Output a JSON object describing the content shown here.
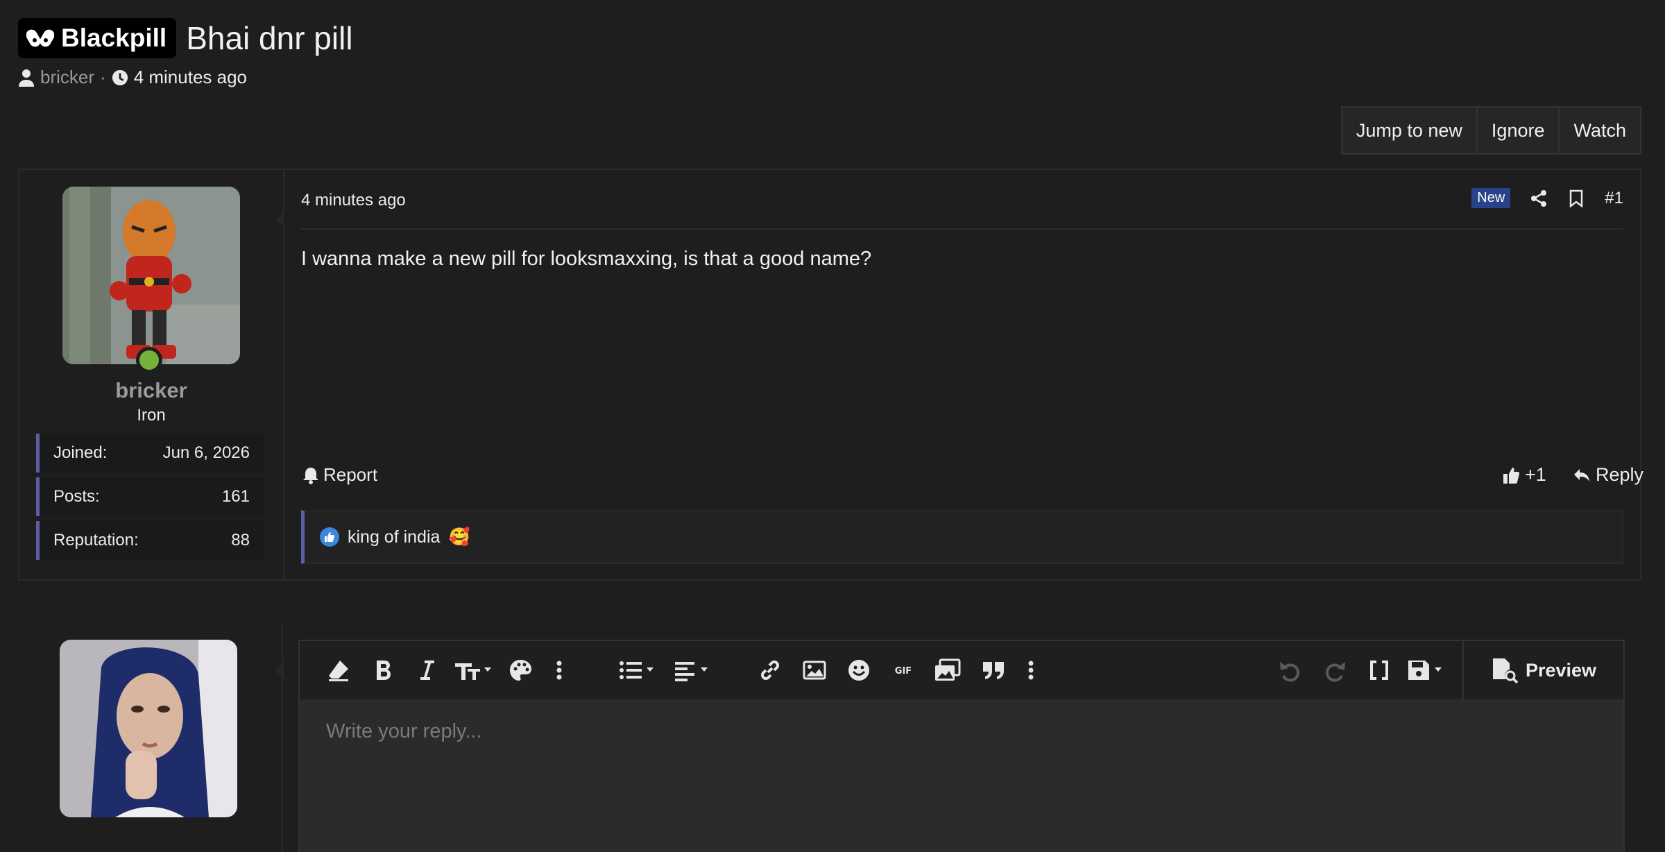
{
  "thread": {
    "prefix": "Blackpill",
    "title": "Bhai dnr pill",
    "author": "bricker",
    "separator": "·",
    "time": "4 minutes ago"
  },
  "actions": {
    "jump": "Jump to new",
    "ignore": "Ignore",
    "watch": "Watch"
  },
  "post": {
    "user": {
      "name": "bricker",
      "title": "Iron",
      "online": true,
      "stats": [
        {
          "label": "Joined:",
          "value": "Jun 6, 2026"
        },
        {
          "label": "Posts:",
          "value": "161"
        },
        {
          "label": "Reputation:",
          "value": "88"
        }
      ]
    },
    "time": "4 minutes ago",
    "badge": "New",
    "number": "#1",
    "body": "I wanna make a new pill for looksmaxxing, is that a good name?",
    "report": "Report",
    "like_count": "+1",
    "reply": "Reply",
    "reactions": {
      "text": "king of india",
      "emoji": "🥰"
    }
  },
  "editor": {
    "placeholder": "Write your reply...",
    "preview": "Preview"
  },
  "colors": {
    "accent": "#5c5ea8",
    "online": "#74b23c",
    "badge": "#28438a"
  }
}
